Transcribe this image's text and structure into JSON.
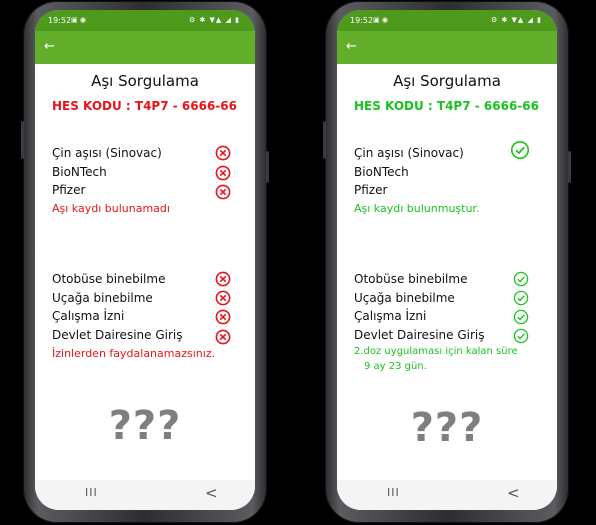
{
  "status": {
    "time": "19:52",
    "right": "⚙ ✱ ▼▲ ◢ ▮"
  },
  "title": "Aşı Sorgulama",
  "colors": {
    "red": "#e8141b",
    "green": "#19c31e",
    "appbar": "#62ad2a"
  },
  "left": {
    "hes": "HES KODU : T4P7 - 6666-66",
    "vaccines": [
      "Çin aşısı (Sinovac)",
      "BioNTech",
      "Pfizer"
    ],
    "vaccine_status": "Aşı kaydı bulunamadı",
    "permissions": [
      "Otobüse binebilme",
      "Uçağa binebilme",
      "Çalışma İzni",
      "Devlet Dairesine Giriş"
    ],
    "permission_status": "İzinlerden faydalanamazsınız.",
    "unknown": "???"
  },
  "right": {
    "hes": "HES KODU : T4P7 - 6666-66",
    "vaccines": [
      "Çin aşısı (Sinovac)",
      "BioNTech",
      "Pfizer"
    ],
    "vaccine_status": "Aşı kaydı bulunmuştur.",
    "permissions": [
      "Otobüse binebilme",
      "Uçağa binebilme",
      "Çalışma İzni",
      "Devlet Dairesine Giriş"
    ],
    "permission_status_line1": "2.doz uygulaması için kalan süre",
    "permission_status_line2": "9 ay 23 gün.",
    "unknown": "???"
  },
  "nav": {
    "recent": "III",
    "back": "<"
  }
}
